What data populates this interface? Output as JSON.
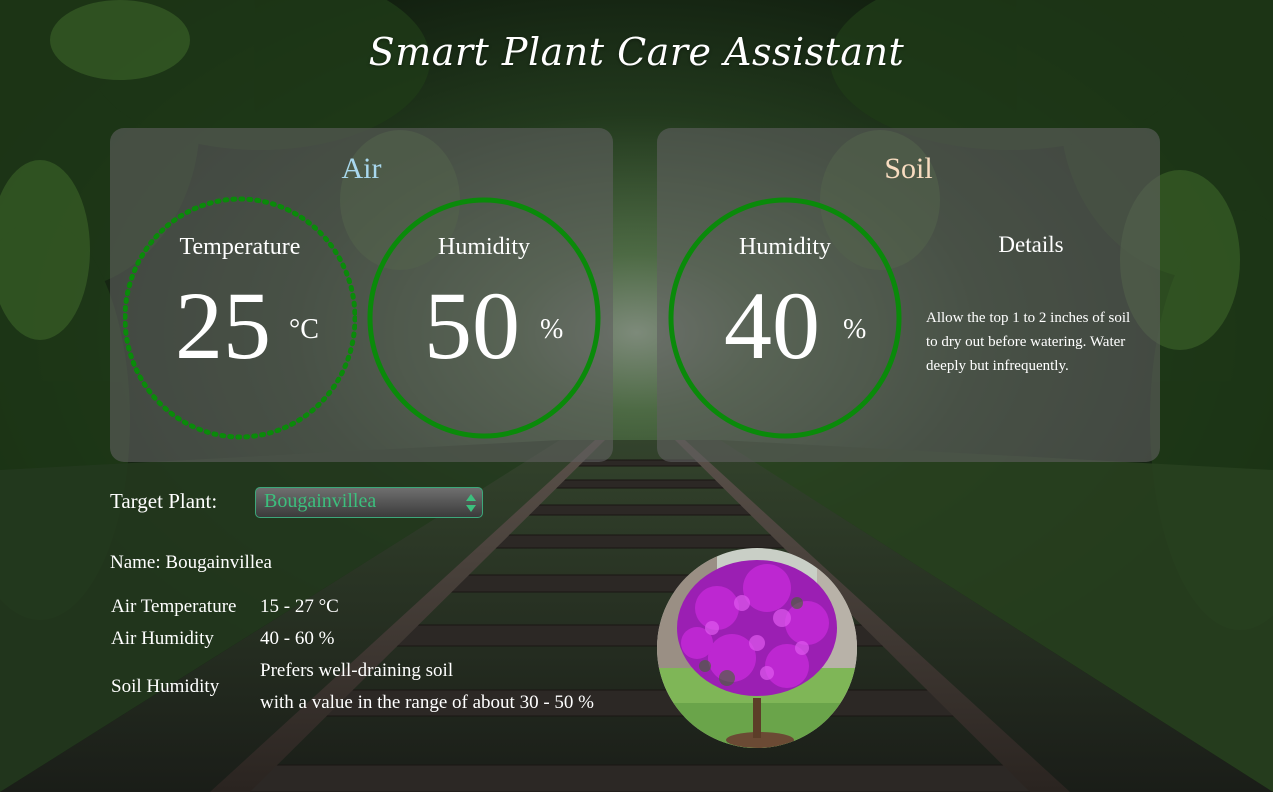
{
  "app": {
    "title": "Smart Plant Care Assistant"
  },
  "air": {
    "title": "Air",
    "temperature": {
      "label": "Temperature",
      "value": "25",
      "unit": "°C"
    },
    "humidity": {
      "label": "Humidity",
      "value": "50",
      "unit": "%"
    }
  },
  "soil": {
    "title": "Soil",
    "humidity": {
      "label": "Humidity",
      "value": "40",
      "unit": "%"
    },
    "details": {
      "title": "Details",
      "text": "Allow the top 1 to 2 inches of soil to dry out before watering. Water deeply but infrequently."
    }
  },
  "target": {
    "label": "Target Plant:",
    "selected": "Bougainvillea"
  },
  "plant_info": {
    "name_line": "Name: Bougainvillea",
    "air_temperature_label": "Air Temperature",
    "air_temperature_value": "15 - 27 °C",
    "air_humidity_label": "Air Humidity",
    "air_humidity_value": "40 - 60 %",
    "soil_humidity_label": "Soil Humidity",
    "soil_humidity_value_line1": "Prefers well-draining soil",
    "soil_humidity_value_line2": "with a value in the range of about 30 - 50 %"
  },
  "colors": {
    "air_title": "#a9d8ee",
    "soil_title": "#f8dcc0",
    "ring": "#0a8a0a",
    "select_text": "#3cbf7d",
    "panel_bg": "rgba(95,95,95,0.62)"
  },
  "icons": {
    "select_arrows": "select-arrows-icon",
    "plant_photo": "bougainvillea-photo"
  }
}
